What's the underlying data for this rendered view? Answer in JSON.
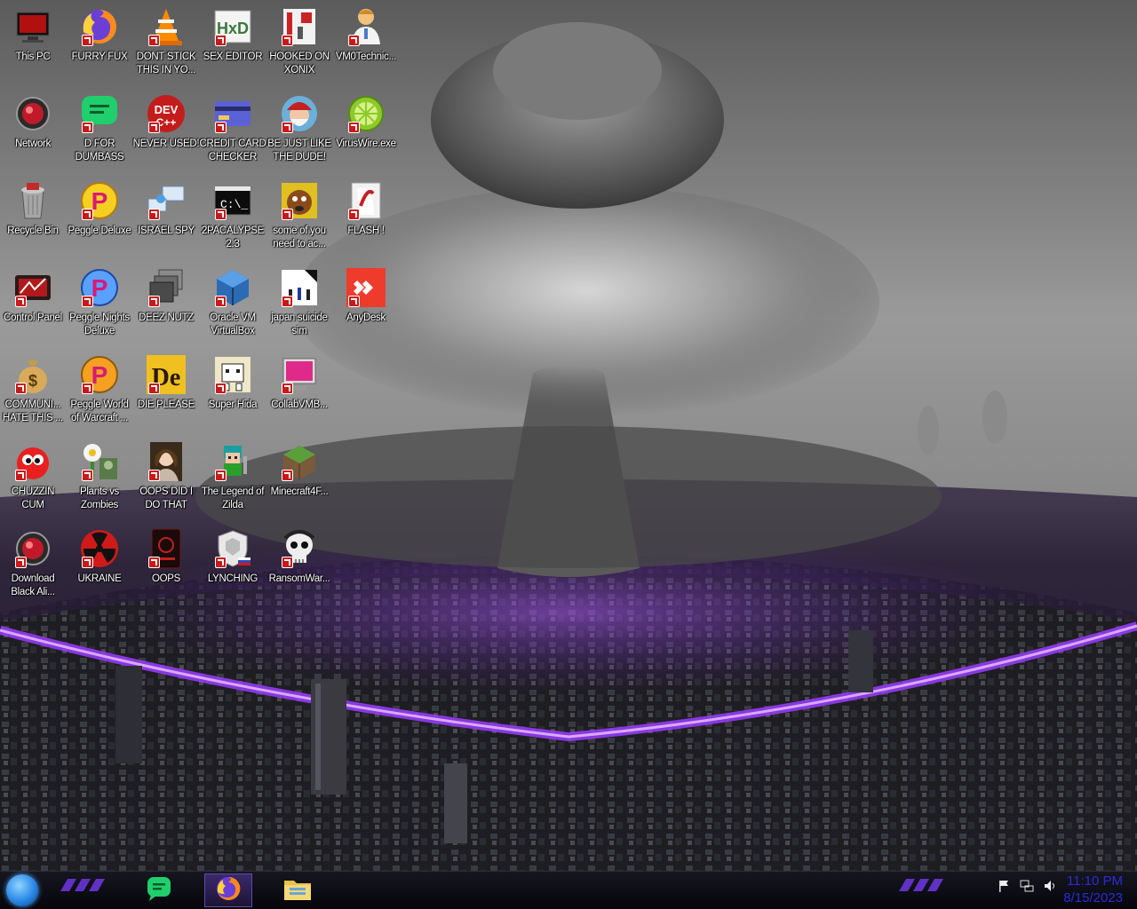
{
  "desktop": {
    "icons": [
      {
        "label": "This PC",
        "icon": "computer-icon",
        "col": 0,
        "row": 0
      },
      {
        "label": "FURRY FUX",
        "icon": "firefox-icon",
        "col": 1,
        "row": 0
      },
      {
        "label": "DONT STICK THIS IN YO...",
        "icon": "vlc-cone-icon",
        "col": 2,
        "row": 0
      },
      {
        "label": "SEX EDITOR",
        "icon": "hxd-hex-editor-icon",
        "col": 3,
        "row": 0
      },
      {
        "label": "HOOKED ON XONIX",
        "icon": "xonix-game-icon",
        "col": 4,
        "row": 0
      },
      {
        "label": "VM0Technic...",
        "icon": "doctor-person-icon",
        "col": 5,
        "row": 0
      },
      {
        "label": "Network",
        "icon": "network-orb-icon",
        "col": 0,
        "row": 1
      },
      {
        "label": "D FOR DUMBASS",
        "icon": "chat-bubble-icon",
        "col": 1,
        "row": 1
      },
      {
        "label": "NEVER USED!",
        "icon": "dev-cpp-icon",
        "col": 2,
        "row": 1
      },
      {
        "label": "CREDIT CARD CHECKER",
        "icon": "credit-card-icon",
        "col": 3,
        "row": 1
      },
      {
        "label": "BE JUST LIKE THE DUDE!",
        "icon": "santa-face-icon",
        "col": 4,
        "row": 1
      },
      {
        "label": "VirusWire.exe",
        "icon": "lime-icon",
        "col": 5,
        "row": 1
      },
      {
        "label": "Recycle Bin",
        "icon": "recycle-bin-icon",
        "col": 0,
        "row": 2
      },
      {
        "label": "Peggle Deluxe",
        "icon": "peggle-icon",
        "col": 1,
        "row": 2
      },
      {
        "label": "ISRAEL SPY",
        "icon": "network-computers-icon",
        "col": 2,
        "row": 2
      },
      {
        "label": "2PACALYPSE 2.3",
        "icon": "terminal-icon",
        "col": 3,
        "row": 2
      },
      {
        "label": "some of you need to ac...",
        "icon": "dog-face-icon",
        "col": 4,
        "row": 2
      },
      {
        "label": "FLASH !",
        "icon": "flash-player-icon",
        "col": 5,
        "row": 2
      },
      {
        "label": "Control Panel",
        "icon": "control-panel-icon",
        "col": 0,
        "row": 3
      },
      {
        "label": "Peggle Nights Deluxe",
        "icon": "peggle-nights-icon",
        "col": 1,
        "row": 3
      },
      {
        "label": "DEEZ NUTZ",
        "icon": "stacked-windows-icon",
        "col": 2,
        "row": 3
      },
      {
        "label": "Oracle VM VirtualBox",
        "icon": "virtualbox-cube-icon",
        "col": 3,
        "row": 3
      },
      {
        "label": "japan suicide sim",
        "icon": "game-cover-icon",
        "col": 4,
        "row": 3
      },
      {
        "label": "AnyDesk",
        "icon": "anydesk-icon",
        "col": 5,
        "row": 3
      },
      {
        "label": "COMMUNI... HATE THIS ...",
        "icon": "money-bag-icon",
        "col": 0,
        "row": 4
      },
      {
        "label": "Peggle World of Warcraft ...",
        "icon": "peggle-wow-icon",
        "col": 1,
        "row": 4
      },
      {
        "label": "DIE PLEASE",
        "icon": "de-logo-icon",
        "col": 2,
        "row": 4
      },
      {
        "label": "Super Hida",
        "icon": "pixel-dog-icon",
        "col": 3,
        "row": 4
      },
      {
        "label": "CollabVMB...",
        "icon": "monitor-icon",
        "col": 4,
        "row": 4
      },
      {
        "label": "CHUZZIN CUM",
        "icon": "chuzzle-icon",
        "col": 0,
        "row": 5
      },
      {
        "label": "Plants vs Zombies",
        "icon": "plants-vs-zombies-icon",
        "col": 1,
        "row": 5
      },
      {
        "label": "OOPS DID I DO THAT",
        "icon": "portrait-icon",
        "col": 2,
        "row": 5
      },
      {
        "label": "The Legend of Zilda",
        "icon": "pixel-hero-icon",
        "col": 3,
        "row": 5
      },
      {
        "label": "Minecraft4F...",
        "icon": "grass-block-icon",
        "col": 4,
        "row": 5
      },
      {
        "label": "Download Black Ali...",
        "icon": "download-orb-icon",
        "col": 0,
        "row": 6
      },
      {
        "label": "UKRAINE",
        "icon": "radiation-icon",
        "col": 1,
        "row": 6
      },
      {
        "label": "OOPS",
        "icon": "dark-card-icon",
        "col": 2,
        "row": 6
      },
      {
        "label": "LYNCHING",
        "icon": "shield-crest-icon",
        "col": 3,
        "row": 6
      },
      {
        "label": "RansomWar...",
        "icon": "skull-icon",
        "col": 4,
        "row": 6
      }
    ]
  },
  "taskbar": {
    "start": "start-orb-icon",
    "pinned": [
      {
        "name": "chat-bubble-icon",
        "active": false
      },
      {
        "name": "firefox-icon",
        "active": true
      },
      {
        "name": "file-explorer-icon",
        "active": false
      }
    ],
    "tray_icons": [
      "flag-icon",
      "network-icon",
      "speaker-icon"
    ],
    "time": "11:10 PM",
    "date": "8/15/2023"
  },
  "colors": {
    "accent_purple": "#8a3cff",
    "clock_text": "#2b2bd8",
    "shortcut_badge": "#c81a1a"
  }
}
